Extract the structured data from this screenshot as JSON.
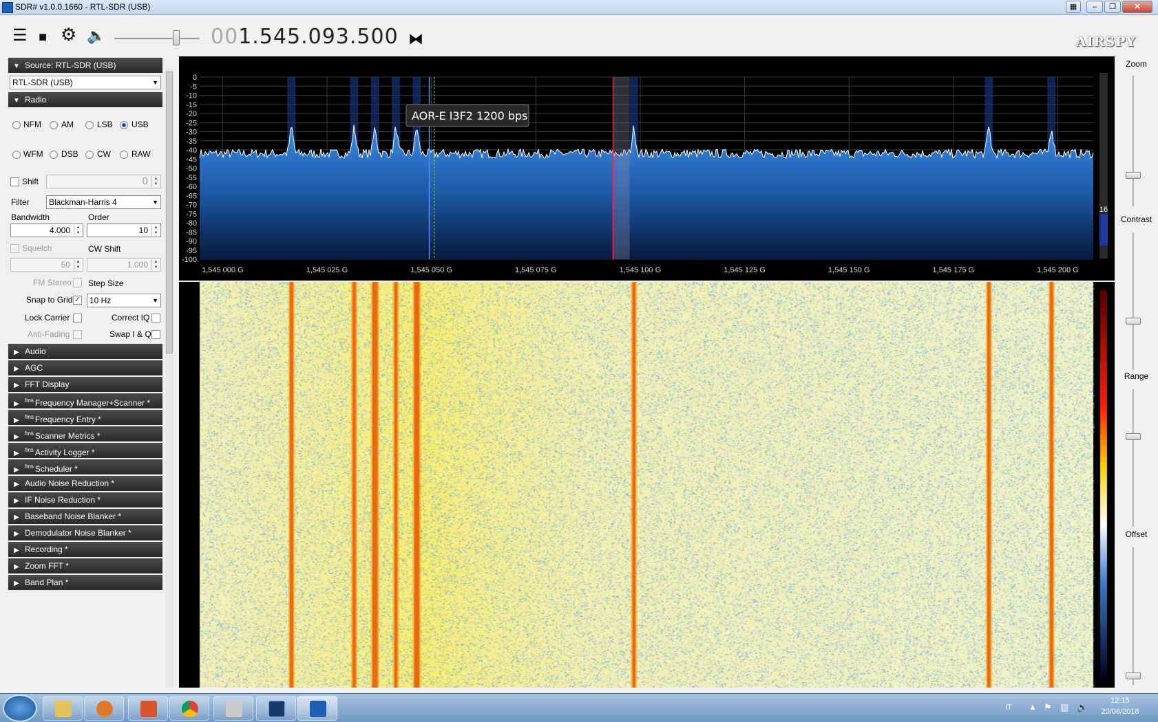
{
  "window": {
    "title": "SDR# v1.0.0.1660 - RTL-SDR (USB)"
  },
  "toolbar": {
    "frequency_dim": "00",
    "frequency_main": "1.545.093.500",
    "logo": "AIRSPY"
  },
  "source": {
    "header": "Source: RTL-SDR (USB)",
    "device": "RTL-SDR (USB)"
  },
  "radio": {
    "header": "Radio",
    "modes": [
      "NFM",
      "AM",
      "LSB",
      "USB",
      "WFM",
      "DSB",
      "CW",
      "RAW"
    ],
    "selected_mode": "USB",
    "shift_label": "Shift",
    "shift_value": "0",
    "filter_label": "Filter",
    "filter_value": "Blackman-Harris 4",
    "bandwidth_label": "Bandwidth",
    "bandwidth_value": "4.000",
    "order_label": "Order",
    "order_value": "10",
    "squelch_label": "Squelch",
    "squelch_value": "50",
    "cw_shift_label": "CW Shift",
    "cw_shift_value": "1.000",
    "fm_stereo_label": "FM Stereo",
    "step_size_label": "Step Size",
    "snap_label": "Snap to Grid",
    "step_value": "10 Hz",
    "lock_carrier_label": "Lock Carrier",
    "correct_iq_label": "Correct IQ",
    "anti_fading_label": "Anti-Fading",
    "swap_iq_label": "Swap I & Q"
  },
  "panels": [
    {
      "label": "Audio",
      "fms": false
    },
    {
      "label": "AGC",
      "fms": false
    },
    {
      "label": "FFT Display",
      "fms": false
    },
    {
      "label": "Frequency Manager+Scanner *",
      "fms": true
    },
    {
      "label": "Frequency Entry *",
      "fms": true
    },
    {
      "label": "Scanner Metrics *",
      "fms": true
    },
    {
      "label": "Activity Logger *",
      "fms": true
    },
    {
      "label": "Scheduler *",
      "fms": true
    },
    {
      "label": "Audio Noise Reduction *",
      "fms": false
    },
    {
      "label": "IF Noise Reduction *",
      "fms": false
    },
    {
      "label": "Baseband Noise Blanker *",
      "fms": false
    },
    {
      "label": "Demodulator Noise Blanker *",
      "fms": false
    },
    {
      "label": "Recording *",
      "fms": false
    },
    {
      "label": "Zoom FFT *",
      "fms": false
    },
    {
      "label": "Band Plan *",
      "fms": false
    }
  ],
  "fms_tag": "fms",
  "spectrum": {
    "tooltip": "AOR-E I3F2 1200 bps",
    "db_ticks": [
      "0",
      "-5",
      "-10",
      "-15",
      "-20",
      "-25",
      "-30",
      "-35",
      "-40",
      "-45",
      "-50",
      "-55",
      "-60",
      "-65",
      "-70",
      "-75",
      "-80",
      "-85",
      "-90",
      "-95",
      "-100"
    ],
    "freq_ticks": [
      "1,545 000 G",
      "1,545 025 G",
      "1,545 050 G",
      "1,545 075 G",
      "1,545 100 G",
      "1,545 125 G",
      "1,545 150 G",
      "1,545 175 G",
      "1,545 200 G"
    ],
    "level_value": "16",
    "signals_mhz": [
      1545.0165,
      1545.0315,
      1545.0365,
      1545.0415,
      1545.0465,
      1545.0985,
      1545.1835,
      1545.1985
    ],
    "tuned_mhz": 1545.0495,
    "marker_mhz": 1545.0935,
    "noise_floor_db": -42
  },
  "right_panel": {
    "zoom_label": "Zoom",
    "contrast_label": "Contrast",
    "range_label": "Range",
    "offset_label": "Offset"
  },
  "taskbar": {
    "language": "IT",
    "time": "12:15",
    "date": "20/06/2018"
  }
}
